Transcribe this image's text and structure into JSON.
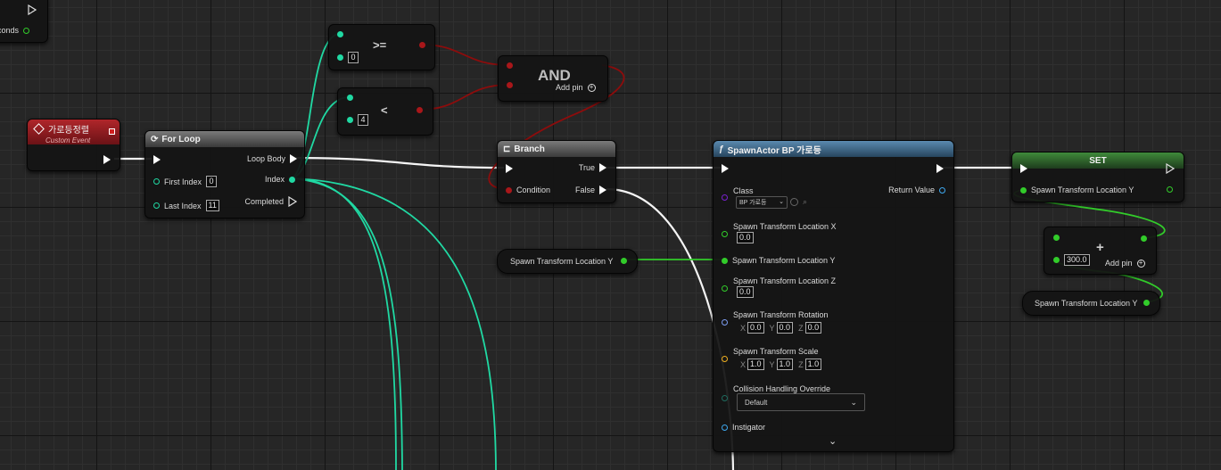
{
  "partial_node": {
    "pin_label": "conds"
  },
  "custom_event": {
    "title": "가로등정렬",
    "subtitle": "Custom Event"
  },
  "for_loop": {
    "title": "For Loop",
    "loop_body": "Loop Body",
    "index": "Index",
    "completed": "Completed",
    "first_index_label": "First Index",
    "first_index_value": "0",
    "last_index_label": "Last Index",
    "last_index_value": "11"
  },
  "compare_ge": {
    "operator": ">=",
    "value": "0"
  },
  "compare_lt": {
    "operator": "<",
    "value": "4"
  },
  "and_node": {
    "title": "AND",
    "add_pin": "Add pin"
  },
  "branch": {
    "title": "Branch",
    "true_label": "True",
    "false_label": "False",
    "condition_label": "Condition"
  },
  "var_get_left": {
    "label": "Spawn Transform Location Y"
  },
  "spawn_actor": {
    "title": "SpawnActor BP 가로등",
    "class_label": "Class",
    "class_value": "BP 가로등",
    "return_value": "Return Value",
    "loc_x_label": "Spawn Transform Location X",
    "loc_x_value": "0.0",
    "loc_y_label": "Spawn Transform Location Y",
    "loc_z_label": "Spawn Transform Location Z",
    "loc_z_value": "0.0",
    "rotation_label": "Spawn Transform Rotation",
    "rotation": {
      "x": "0.0",
      "y": "0.0",
      "z": "0.0"
    },
    "scale_label": "Spawn Transform Scale",
    "scale": {
      "x": "1.0",
      "y": "1.0",
      "z": "1.0"
    },
    "collision_label": "Collision Handling Override",
    "collision_value": "Default",
    "instigator_label": "Instigator",
    "axis_x": "X",
    "axis_y": "Y",
    "axis_z": "Z"
  },
  "set_node": {
    "title": "SET",
    "pin_label": "Spawn Transform Location Y"
  },
  "add_node": {
    "operator": "+",
    "value": "300.0",
    "add_pin": "Add pin"
  },
  "var_get_right": {
    "label": "Spawn Transform Location Y"
  },
  "colors": {
    "exec": "#ffffff",
    "integer": "#20d9a3",
    "boolean": "#8d0c0c",
    "float": "#32cc2a",
    "object": "#3ea9f0",
    "class": "#7a20d0",
    "rotator": "#7c9cf0",
    "vector": "#f0b020",
    "event_header": "#b0262a",
    "function_header": "#5a8ab0",
    "set_header": "#3f8a3a"
  }
}
